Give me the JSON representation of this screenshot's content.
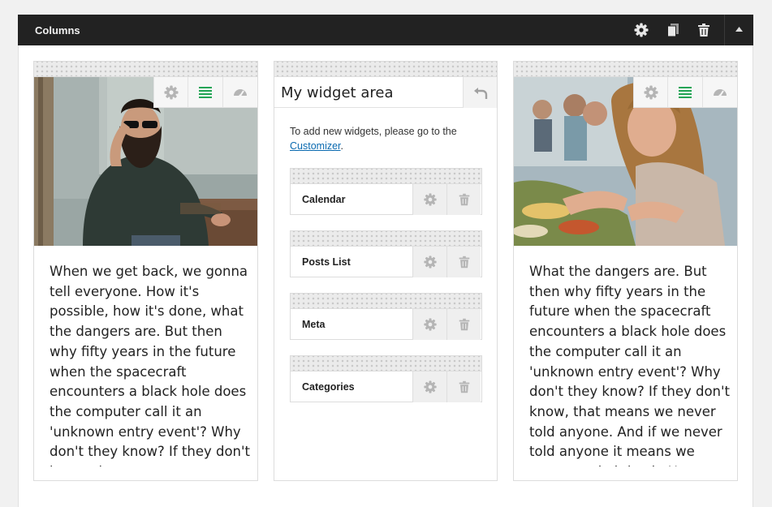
{
  "titlebar": {
    "title": "Columns",
    "icons": [
      "gear-icon",
      "copy-icon",
      "trash-icon",
      "collapse-arrow-icon"
    ]
  },
  "colors": {
    "titlebar_bg": "#222222",
    "accent_green": "#23a455",
    "link_blue": "#0a6ab0"
  },
  "columns": [
    {
      "type": "image-text",
      "tools": [
        "gear-icon",
        "list-icon",
        "gauge-icon"
      ],
      "text": "When we get back, we gonna tell everyone. How it's possible, how it's done, what the dangers are. But then why fifty years in the future when the spacecraft encounters a black hole does the computer call it an 'unknown entry event'? Why don't they know? If they don't know, that means we never told anyone. And if we never told"
    },
    {
      "type": "widget-area",
      "title": "My widget area",
      "help_text": "To add new widgets, please go to the ",
      "help_link": "Customizer",
      "help_end": ".",
      "widgets": [
        {
          "label": "Calendar"
        },
        {
          "label": "Posts List"
        },
        {
          "label": "Meta"
        },
        {
          "label": "Categories"
        }
      ]
    },
    {
      "type": "image-text",
      "tools": [
        "gear-icon",
        "list-icon",
        "gauge-icon"
      ],
      "text": "What the dangers are. But then why fifty years in the future when the spacecraft encounters a black hole does the computer call it an 'unknown entry event'? Why don't they know? If they don't know, that means we never told anyone. And if we never told anyone it means we never made it back. Hence we die"
    }
  ]
}
